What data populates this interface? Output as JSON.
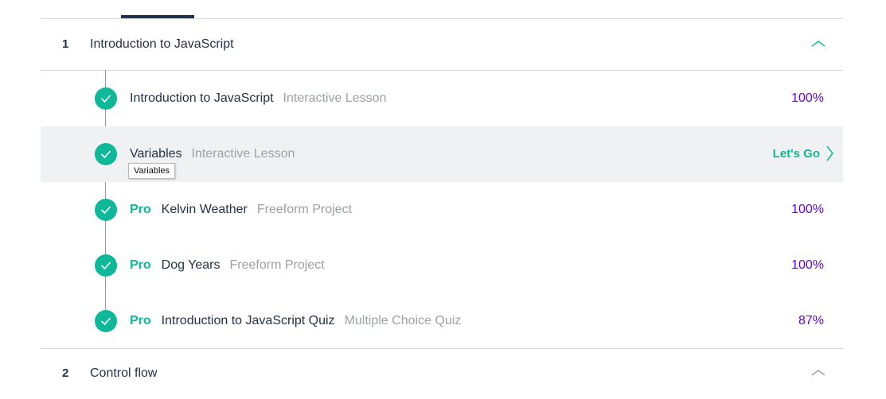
{
  "colors": {
    "accent": "#0fb898",
    "percent": "#6400e4",
    "text": "#22324a",
    "muted": "#9da0a8",
    "highlight_row": "#f0f1f3"
  },
  "sections": [
    {
      "number": "1",
      "title": "Introduction to JavaScript",
      "expanded": true,
      "toggle_icon": "chevron-up-icon"
    },
    {
      "number": "2",
      "title": "Control flow",
      "expanded": false,
      "toggle_icon": "chevron-up-icon"
    }
  ],
  "lessons": [
    {
      "pro": "",
      "name": "Introduction to JavaScript",
      "type": "Interactive Lesson",
      "progress": "100%",
      "completed": true
    },
    {
      "pro": "",
      "name": "Variables",
      "type": "Interactive Lesson",
      "action": "Let's Go",
      "completed": true,
      "hovered": true
    },
    {
      "pro": "Pro",
      "name": "Kelvin Weather",
      "type": "Freeform Project",
      "progress": "100%",
      "completed": true
    },
    {
      "pro": "Pro",
      "name": "Dog Years",
      "type": "Freeform Project",
      "progress": "100%",
      "completed": true
    },
    {
      "pro": "Pro",
      "name": "Introduction to JavaScript Quiz",
      "type": "Multiple Choice Quiz",
      "progress": "87%",
      "completed": true
    }
  ],
  "tooltip": "Variables"
}
